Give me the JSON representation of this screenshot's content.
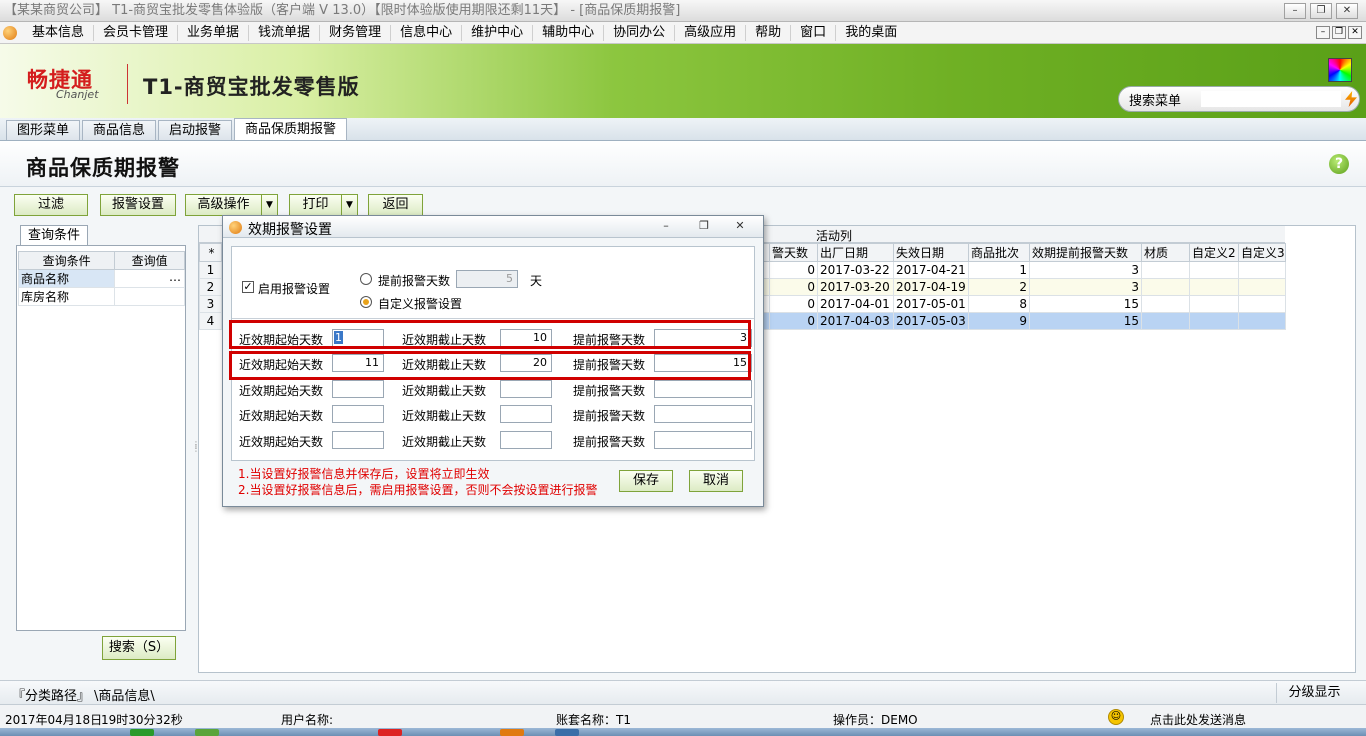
{
  "window": {
    "title": "【某某商贸公司】 T1-商贸宝批发零售体验版（客户端 V 13.0）【限时体验版使用期限还剩11天】 - [商品保质期报警]",
    "controls": [
      "–",
      "❐",
      "✕"
    ]
  },
  "menu": {
    "items": [
      "基本信息",
      "会员卡管理",
      "业务单据",
      "钱流单据",
      "财务管理",
      "信息中心",
      "维护中心",
      "辅助中心",
      "协同办公",
      "高级应用",
      "帮助",
      "窗口",
      "我的桌面"
    ],
    "mdi_controls": [
      "–",
      "❐",
      "✕"
    ]
  },
  "banner": {
    "brand": "畅捷通",
    "brand_en": "Chanjet",
    "product": "T1-商贸宝批发零售版",
    "search_label": "搜索菜单",
    "search_value": ""
  },
  "tabs": [
    "图形菜单",
    "商品信息",
    "启动报警",
    "商品保质期报警"
  ],
  "page": {
    "title": "商品保质期报警",
    "help": "?"
  },
  "toolbar": {
    "filter": "过滤",
    "alarm_settings": "报警设置",
    "advanced": "高级操作",
    "print": "打印",
    "back": "返回",
    "dropdown_glyph": "▼"
  },
  "query_panel": {
    "tab": "查询条件",
    "headers": [
      "查询条件",
      "查询值"
    ],
    "rows": [
      {
        "name": "商品名称",
        "value": "",
        "button": "…"
      },
      {
        "name": "库房名称",
        "value": ""
      }
    ],
    "search_button": "搜索（S）"
  },
  "grid": {
    "group_label": "活动列",
    "star": "*",
    "headers": [
      "警天数",
      "出厂日期",
      "失效日期",
      "商品批次",
      "效期提前报警天数",
      "材质",
      "自定义2",
      "自定义3"
    ],
    "rows": [
      {
        "n": "1",
        "days": "0",
        "mfg": "2017-03-22",
        "exp": "2017-04-21",
        "batch": "1",
        "advance": "3",
        "m": "",
        "c2": "",
        "c3": ""
      },
      {
        "n": "2",
        "days": "0",
        "mfg": "2017-03-20",
        "exp": "2017-04-19",
        "batch": "2",
        "advance": "3",
        "m": "",
        "c2": "",
        "c3": ""
      },
      {
        "n": "3",
        "days": "0",
        "mfg": "2017-04-01",
        "exp": "2017-05-01",
        "batch": "8",
        "advance": "15",
        "m": "",
        "c2": "",
        "c3": ""
      },
      {
        "n": "4",
        "days": "0",
        "mfg": "2017-04-03",
        "exp": "2017-05-03",
        "batch": "9",
        "advance": "15",
        "m": "",
        "c2": "",
        "c3": ""
      }
    ]
  },
  "statusbar": {
    "path_label": "『分类路径』",
    "path_value": "\\商品信息\\",
    "category_display": "分级显示"
  },
  "infobar": {
    "date": "2017年04月18日",
    "time": "19时30分32秒",
    "user_label": "用户名称:",
    "account": "账套名称：T1",
    "operator": "操作员：DEMO",
    "message": "点击此处发送消息",
    "smiley": "☺"
  },
  "dialog": {
    "title": "效期报警设置",
    "controls": [
      "–",
      "❐",
      "✕"
    ],
    "enable_label": "启用报警设置",
    "enable_checked": "✓",
    "advance_days_label": "提前报警天数",
    "advance_days_value": "5",
    "advance_days_unit": "天",
    "custom_label": "自定义报警设置",
    "row_labels": {
      "start": "近效期起始天数",
      "end": "近效期截止天数",
      "advance": "提前报警天数"
    },
    "rows": [
      {
        "start": "1",
        "end": "10",
        "advance": "3"
      },
      {
        "start": "11",
        "end": "20",
        "advance": "15"
      },
      {
        "start": "",
        "end": "",
        "advance": ""
      },
      {
        "start": "",
        "end": "",
        "advance": ""
      },
      {
        "start": "",
        "end": "",
        "advance": ""
      }
    ],
    "notes": [
      "1.当设置好报警信息并保存后，设置将立即生效",
      "2.当设置好报警信息后，需启用报警设置，否则不会按设置进行报警"
    ],
    "save": "保存",
    "cancel": "取消"
  },
  "colors": {
    "alarm_highlight": "#d00000",
    "brand_green": "#6fb024",
    "row_selected": "#b9d3f3"
  }
}
